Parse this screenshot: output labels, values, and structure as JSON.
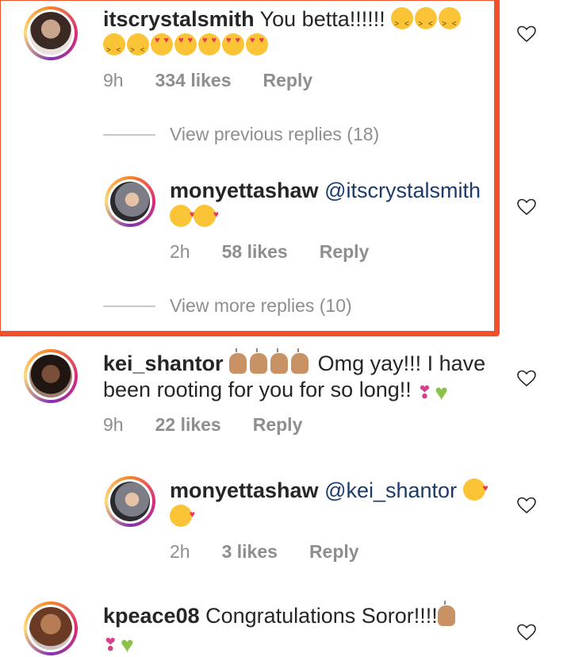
{
  "comments": [
    {
      "username": "itscrystalsmith",
      "text": " You betta!!!!!! ",
      "time": "9h",
      "likes": "334 likes",
      "reply": "Reply"
    },
    {
      "username": "monyettashaw",
      "mention": " @itscrystalsmith",
      "time": "2h",
      "likes": "58 likes",
      "reply": "Reply"
    },
    {
      "username": "kei_shantor",
      "text1": " Omg yay!!! I have",
      "text2": "been rooting for you for so long!! ",
      "time": "9h",
      "likes": "22 likes",
      "reply": "Reply"
    },
    {
      "username": "monyettashaw",
      "mention": " @kei_shantor",
      "time": "2h",
      "likes": "3 likes",
      "reply": "Reply"
    },
    {
      "username": "kpeace08",
      "text": " Congratulations Soror!!!!"
    }
  ],
  "view_previous": "View previous replies (18)",
  "view_more": "View more replies (10)",
  "colors": {
    "highlight": "#f0502a",
    "mention": "#1a3b6b",
    "meta": "#8e8e8e"
  },
  "icons": [
    "heart-outline-icon",
    "avatar",
    "emoji"
  ]
}
